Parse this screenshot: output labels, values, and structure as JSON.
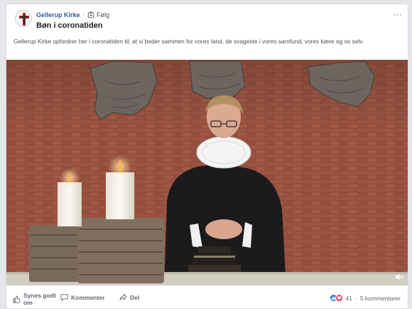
{
  "post": {
    "page_name": "Gellerup Kirke",
    "separator": "·",
    "follow_label": "Følg",
    "title": "Bøn i coronatiden",
    "more_label": "···",
    "description": "Gellerup Kirke opfordrer her i coronatiden til, at vi beder sammen for vores land, de svageste i vores samfund, vores kære og os selv."
  },
  "actions": {
    "like_label": "Synes godt om",
    "comment_label": "Kommenter",
    "share_label": "Del"
  },
  "stats": {
    "reactions_count": "41",
    "separator": "·",
    "comments_count": "5 kommentarer"
  },
  "icons": {
    "avatar": "church-logo-icon",
    "follow": "follow-icon",
    "more": "more-options-icon",
    "speaker": "speaker-muted-icon",
    "like": "thumbs-up-icon",
    "comment": "comment-icon",
    "share": "share-icon",
    "reaction_like": "like-reaction-icon",
    "reaction_love": "love-reaction-icon"
  },
  "colors": {
    "link": "#385898",
    "like_blue": "#1877f2",
    "love_red": "#f33e58"
  }
}
